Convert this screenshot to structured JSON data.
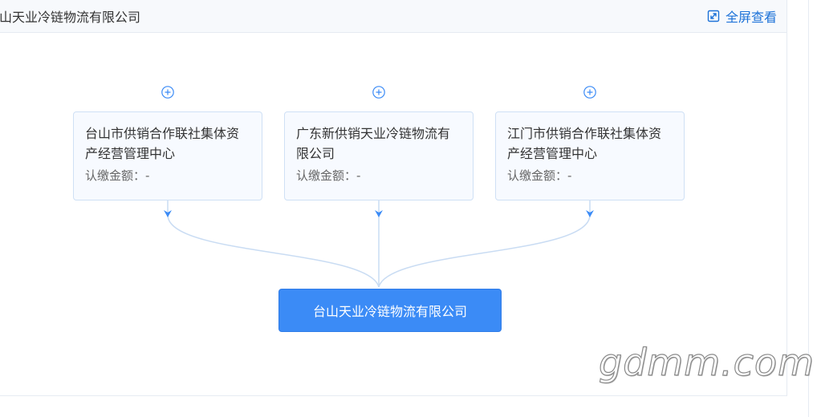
{
  "header": {
    "title": "山天业冷链物流有限公司",
    "fullscreen_label": "全屏查看",
    "fullscreen_icon": "expand-icon"
  },
  "shareholders": [
    {
      "name": "台山市供销合作联社集体资产经营管理中心",
      "amount_label": "认缴金额：-"
    },
    {
      "name": "广东新供销天业冷链物流有限公司",
      "amount_label": "认缴金额：-"
    },
    {
      "name": "江门市供销合作联社集体资产经营管理中心",
      "amount_label": "认缴金额：-"
    }
  ],
  "company": {
    "name": "台山天业冷链物流有限公司"
  },
  "watermark": "gdmm.com",
  "colors": {
    "accent": "#3b8bf6",
    "link": "#1d72d8",
    "node_bg": "#f7faff",
    "node_border": "#cfe0f5",
    "connector": "#c9dcf3"
  }
}
